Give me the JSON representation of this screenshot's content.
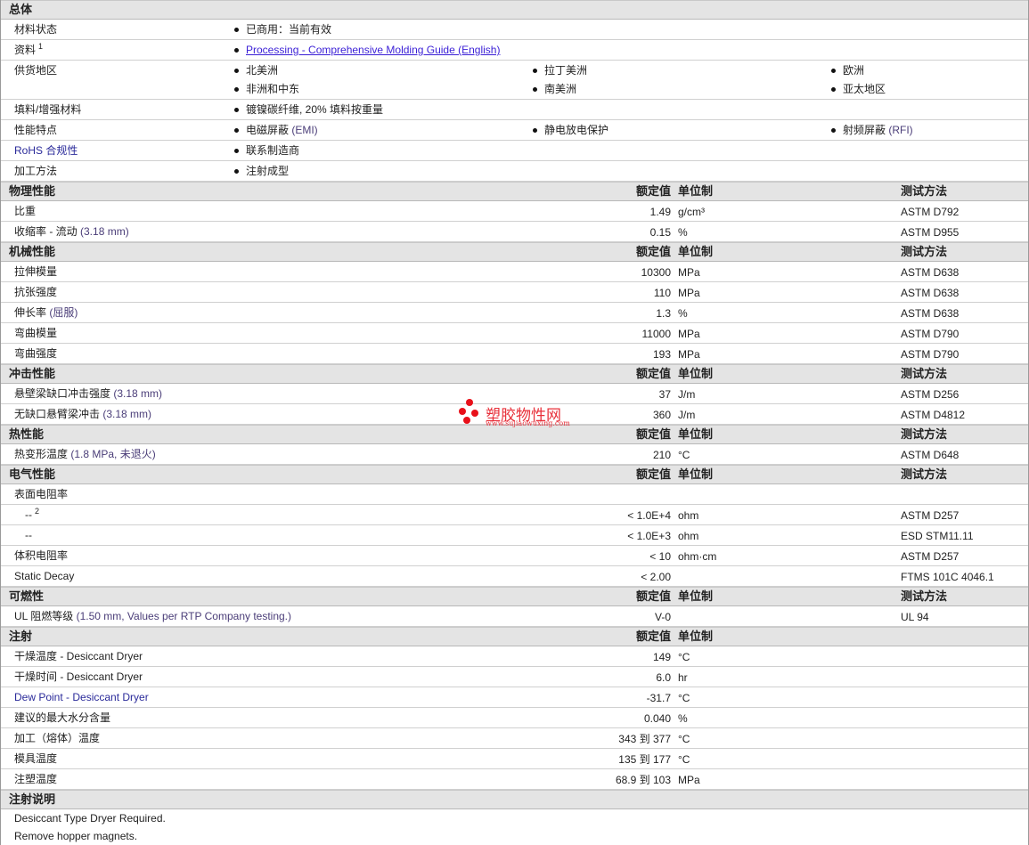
{
  "general": {
    "title": "总体",
    "rows": [
      {
        "label": "材料状态",
        "lines": [
          [
            "已商用：当前有效"
          ]
        ]
      },
      {
        "label": "资料",
        "sup": "1",
        "lines": [
          [
            "Processing - Comprehensive Molding Guide (English)"
          ]
        ],
        "link": true
      },
      {
        "label": "供货地区",
        "lines": [
          [
            "北美洲",
            "拉丁美洲",
            "欧洲"
          ],
          [
            "非洲和中东",
            "南美洲",
            "亚太地区"
          ]
        ]
      },
      {
        "label": "填料/增强材料",
        "lines": [
          [
            "镀镍碳纤维, 20% 填料按重量"
          ]
        ]
      },
      {
        "label": "性能特点",
        "lines": [
          [
            "电磁屏蔽 (EMI)",
            "静电放电保护",
            "射频屏蔽 (RFI)"
          ]
        ]
      },
      {
        "label": "RoHS 合规性",
        "lines": [
          [
            "联系制造商"
          ]
        ],
        "rohs": true
      },
      {
        "label": "加工方法",
        "lines": [
          [
            "注射成型"
          ]
        ]
      }
    ]
  },
  "col_headers": {
    "value": "额定值",
    "unit": "单位制",
    "method": "测试方法"
  },
  "sections": [
    {
      "title": "物理性能",
      "method": true,
      "rows": [
        {
          "label": "比重",
          "value": "1.49",
          "unit": "g/cm³",
          "method": "ASTM D792"
        },
        {
          "label": "收缩率 - 流动",
          "paren": "(3.18 mm)",
          "value": "0.15",
          "unit": "%",
          "method": "ASTM D955"
        }
      ]
    },
    {
      "title": "机械性能",
      "method": true,
      "rows": [
        {
          "label": "拉伸模量",
          "value": "10300",
          "unit": "MPa",
          "method": "ASTM D638"
        },
        {
          "label": "抗张强度",
          "value": "110",
          "unit": "MPa",
          "method": "ASTM D638"
        },
        {
          "label": "伸长率",
          "paren": "(屈服)",
          "value": "1.3",
          "unit": "%",
          "method": "ASTM D638"
        },
        {
          "label": "弯曲模量",
          "value": "11000",
          "unit": "MPa",
          "method": "ASTM D790"
        },
        {
          "label": "弯曲强度",
          "value": "193",
          "unit": "MPa",
          "method": "ASTM D790"
        }
      ]
    },
    {
      "title": "冲击性能",
      "method": true,
      "rows": [
        {
          "label": "悬壁梁缺口冲击强度",
          "paren": "(3.18 mm)",
          "value": "37",
          "unit": "J/m",
          "method": "ASTM D256"
        },
        {
          "label": "无缺口悬臂梁冲击",
          "paren": "(3.18 mm)",
          "value": "360",
          "unit": "J/m",
          "method": "ASTM D4812"
        }
      ]
    },
    {
      "title": "热性能",
      "method": true,
      "rows": [
        {
          "label": "热变形温度",
          "paren": "(1.8 MPa, 未退火)",
          "value": "210",
          "unit": "°C",
          "method": "ASTM D648"
        }
      ]
    },
    {
      "title": "电气性能",
      "method": true,
      "rows": [
        {
          "label": "表面电阻率"
        },
        {
          "label": "--",
          "sup": "2",
          "indent": true,
          "value": "< 1.0E+4",
          "unit": "ohm",
          "method": "ASTM D257"
        },
        {
          "label": "--",
          "indent": true,
          "value": "< 1.0E+3",
          "unit": "ohm",
          "method": "ESD STM11.11"
        },
        {
          "label": "体积电阻率",
          "value": "< 10",
          "unit": "ohm·cm",
          "method": "ASTM D257"
        },
        {
          "label": "Static Decay",
          "value": "< 2.00",
          "method": "FTMS 101C 4046.1"
        }
      ]
    },
    {
      "title": "可燃性",
      "method": true,
      "rows": [
        {
          "label": "UL 阻燃等级",
          "paren": "(1.50 mm, Values per RTP Company testing.)",
          "value": "V-0",
          "method": "UL 94"
        }
      ]
    },
    {
      "title": "注射",
      "method": false,
      "rows": [
        {
          "label": "干燥温度 - Desiccant Dryer",
          "value": "149",
          "unit": "°C"
        },
        {
          "label": "干燥时间 - Desiccant Dryer",
          "value": "6.0",
          "unit": "hr"
        },
        {
          "label": "Dew Point - Desiccant Dryer",
          "value": "-31.7",
          "unit": "°C",
          "rohs": true
        },
        {
          "label": "建议的最大水分含量",
          "value": "0.040",
          "unit": "%"
        },
        {
          "label": "加工（熔体）温度",
          "value": "343 到  377",
          "unit": "°C"
        },
        {
          "label": "模具温度",
          "value": "135 到  177",
          "unit": "°C"
        },
        {
          "label": "注塑温度",
          "value": "68.9 到  103",
          "unit": "MPa"
        }
      ]
    }
  ],
  "notes": {
    "title": "注射说明",
    "lines": [
      "Desiccant Type Dryer Required.",
      "Remove hopper magnets."
    ]
  },
  "watermark": {
    "text": "塑胶物性网",
    "url": "www.sujiaowuxing.com"
  }
}
